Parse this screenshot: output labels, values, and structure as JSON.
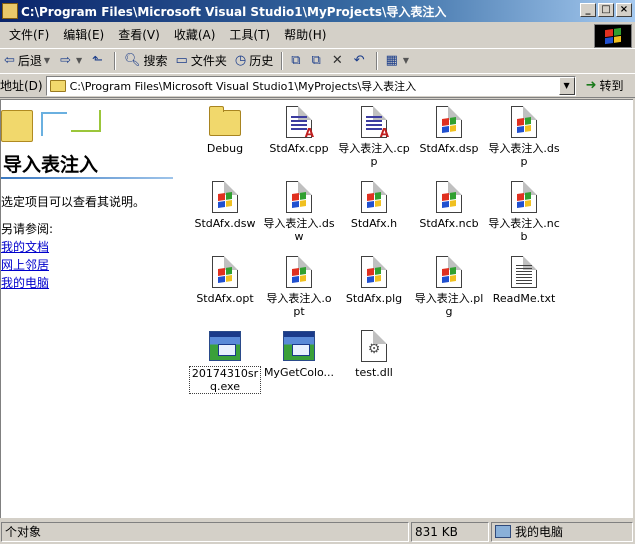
{
  "window": {
    "title": "C:\\Program Files\\Microsoft Visual Studio1\\MyProjects\\导入表注入",
    "min_label": "_",
    "max_label": "□",
    "close_label": "×"
  },
  "menu": [
    "文件(F)",
    "编辑(E)",
    "查看(V)",
    "收藏(A)",
    "工具(T)",
    "帮助(H)"
  ],
  "toolbar": {
    "back_label": "后退",
    "search_label": "搜索",
    "folders_label": "文件夹",
    "history_label": "历史"
  },
  "address": {
    "label": "地址(D)",
    "value": "C:\\Program Files\\Microsoft Visual Studio1\\MyProjects\\导入表注入",
    "go_label": "转到"
  },
  "left_pane": {
    "title": "导入表注入",
    "hint": "选定项目可以查看其说明。",
    "see_also": "另请参阅:",
    "links": [
      "我的文档",
      "网上邻居",
      "我的电脑"
    ]
  },
  "files": [
    {
      "name": "Debug",
      "type": "folder"
    },
    {
      "name": "StdAfx.cpp",
      "type": "cpp"
    },
    {
      "name": "导入表注入.cpp",
      "type": "cpp"
    },
    {
      "name": "StdAfx.dsp",
      "type": "vs"
    },
    {
      "name": "导入表注入.dsp",
      "type": "vs"
    },
    {
      "name": "StdAfx.dsw",
      "type": "vs"
    },
    {
      "name": "导入表注入.dsw",
      "type": "vs"
    },
    {
      "name": "StdAfx.h",
      "type": "vs"
    },
    {
      "name": "StdAfx.ncb",
      "type": "vs"
    },
    {
      "name": "导入表注入.ncb",
      "type": "vs"
    },
    {
      "name": "StdAfx.opt",
      "type": "vs"
    },
    {
      "name": "导入表注入.opt",
      "type": "vs"
    },
    {
      "name": "StdAfx.plg",
      "type": "vs"
    },
    {
      "name": "导入表注入.plg",
      "type": "vs"
    },
    {
      "name": "ReadMe.txt",
      "type": "txt"
    },
    {
      "name": "20174310srq.exe",
      "type": "exe"
    },
    {
      "name": "MyGetColo...",
      "type": "exe"
    },
    {
      "name": "test.dll",
      "type": "dll"
    }
  ],
  "status": {
    "objects": "个对象",
    "size": "831 KB",
    "location": "我的电脑"
  }
}
